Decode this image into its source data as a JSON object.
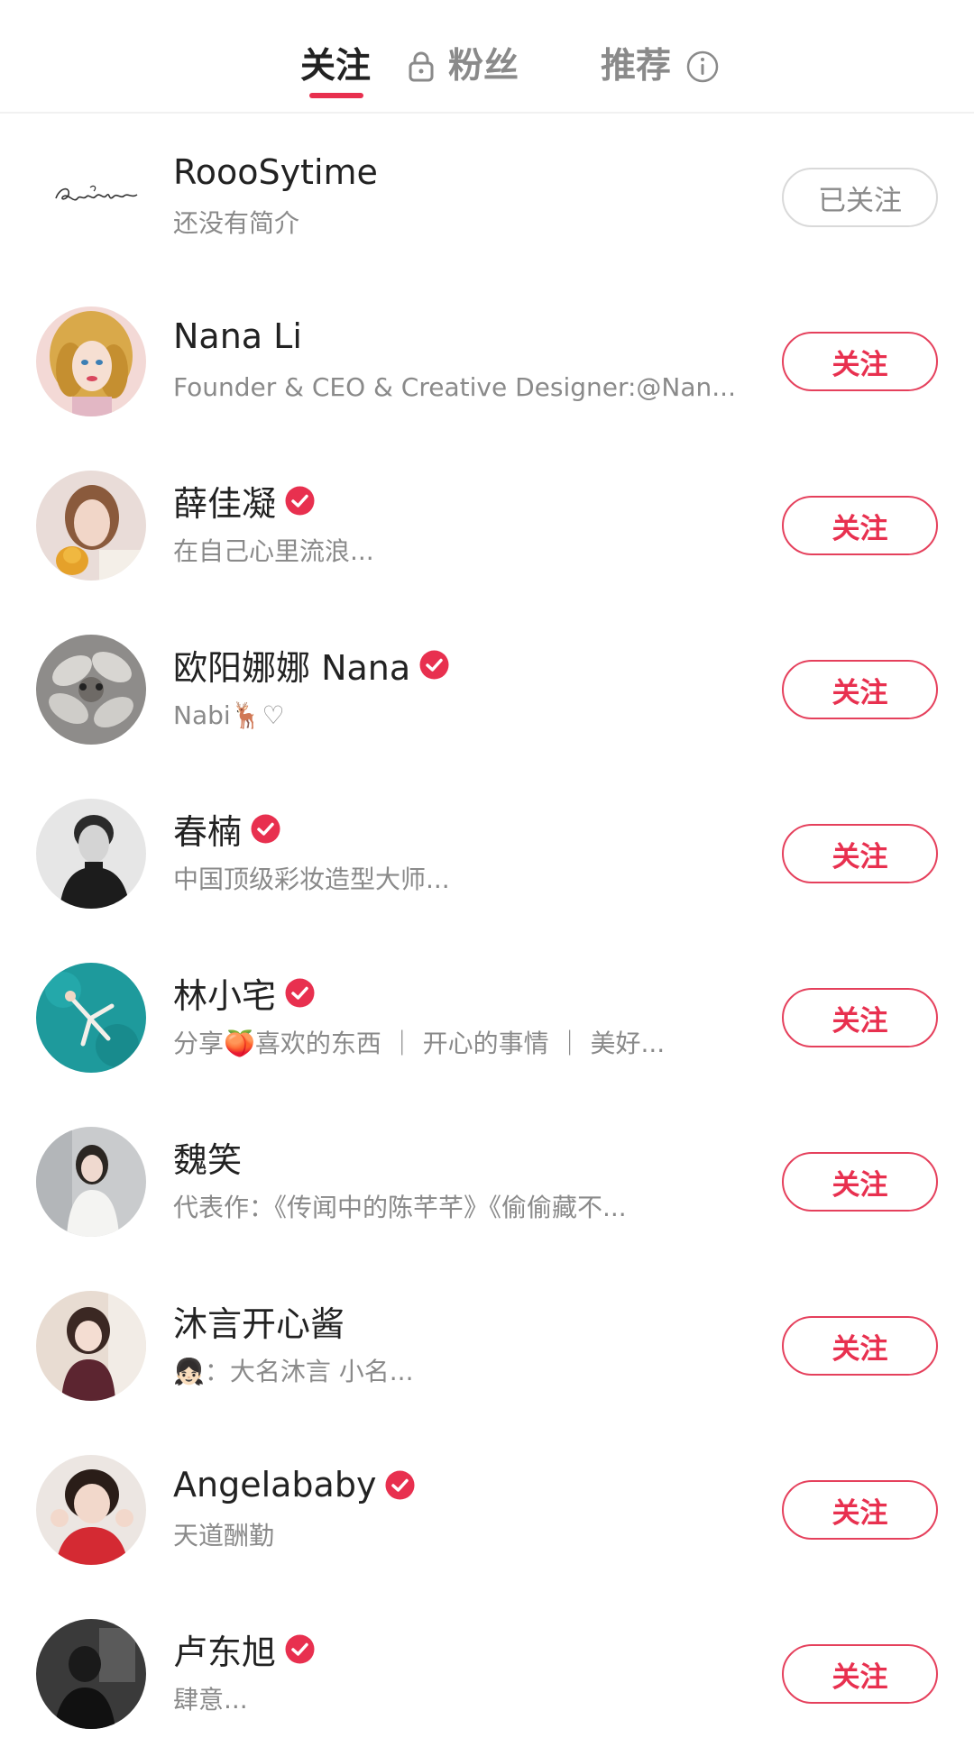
{
  "tabs": {
    "following": "关注",
    "fans": "粉丝",
    "recommended": "推荐"
  },
  "colors": {
    "accent": "#e8304f",
    "followed_border": "#d9d9d9",
    "secondary_text": "#8a8a8a"
  },
  "users": [
    {
      "name": "RoooSytime",
      "bio": "还没有简介",
      "verified": false,
      "button": "已关注",
      "avatar": "signature-logo"
    },
    {
      "name": "Nana Li",
      "bio": "Founder & CEO & Creative Designer:@Nan...",
      "verified": false,
      "button": "关注",
      "avatar": "illustrated-portrait"
    },
    {
      "name": "薛佳凝",
      "bio": "在自己心里流浪...",
      "verified": true,
      "button": "关注",
      "avatar": "photo-portrait"
    },
    {
      "name": "欧阳娜娜 Nana",
      "bio": "Nabi🦌♡",
      "verified": true,
      "button": "关注",
      "avatar": "flower-photo"
    },
    {
      "name": "春楠",
      "bio": "中国顶级彩妆造型大师...",
      "verified": true,
      "button": "关注",
      "avatar": "bw-portrait"
    },
    {
      "name": "林小宅",
      "bio": "分享🍑喜欢的东西 ｜ 开心的事情 ｜ 美好...",
      "verified": true,
      "button": "关注",
      "avatar": "pool-photo"
    },
    {
      "name": "魏笑",
      "bio": "代表作：《传闻中的陈芊芊》《偷偷藏不...",
      "verified": false,
      "button": "关注",
      "avatar": "white-coat-photo"
    },
    {
      "name": "沐言开心酱",
      "bio": "👧🏻：大名沐言 小名...",
      "verified": false,
      "button": "关注",
      "avatar": "girl-photo"
    },
    {
      "name": "Angelababy",
      "bio": "天道酬勤",
      "verified": true,
      "button": "关注",
      "avatar": "red-jacket-photo"
    },
    {
      "name": "卢东旭",
      "bio": "肆意...",
      "verified": true,
      "button": "关注",
      "avatar": "dark-photo"
    }
  ]
}
